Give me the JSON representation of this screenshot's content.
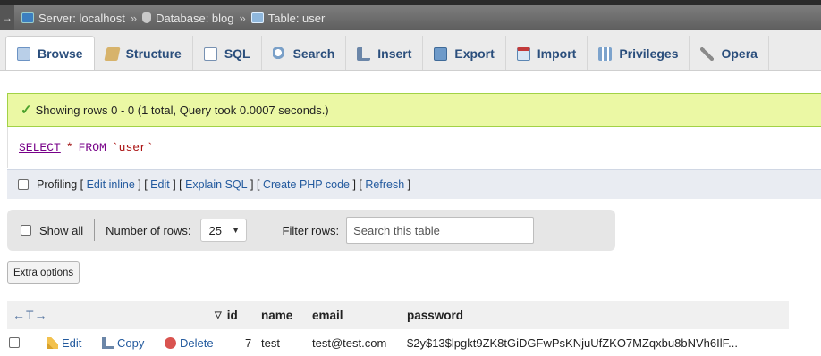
{
  "breadcrumb": {
    "server": "Server: localhost",
    "database": "Database: blog",
    "table": "Table: user",
    "separator": "»",
    "collapse": "→"
  },
  "tabs": [
    {
      "label": "Browse",
      "icon": "browse-icon",
      "active": true
    },
    {
      "label": "Structure",
      "icon": "structure-icon"
    },
    {
      "label": "SQL",
      "icon": "sql-icon"
    },
    {
      "label": "Search",
      "icon": "search-icon"
    },
    {
      "label": "Insert",
      "icon": "insert-icon"
    },
    {
      "label": "Export",
      "icon": "export-icon"
    },
    {
      "label": "Import",
      "icon": "import-icon"
    },
    {
      "label": "Privileges",
      "icon": "privileges-icon"
    },
    {
      "label": "Opera",
      "icon": "operations-icon"
    }
  ],
  "message": {
    "check": "✓",
    "text": "Showing rows 0 - 0 (1 total, Query took 0.0007 seconds.)"
  },
  "query": {
    "select": "SELECT",
    "star": "*",
    "from": "FROM",
    "table": "`user`"
  },
  "profiling": {
    "label": "Profiling",
    "links": [
      "Edit inline",
      "Edit",
      "Explain SQL",
      "Create PHP code",
      "Refresh"
    ]
  },
  "navigation": {
    "show_all": "Show all",
    "rows_label": "Number of rows:",
    "rows_value": "25",
    "filter_label": "Filter rows:",
    "filter_placeholder": "Search this table"
  },
  "extra_options": "Extra options",
  "table": {
    "arrows": "←T→",
    "sort_indicator": "▽",
    "columns": [
      "id",
      "name",
      "email",
      "password"
    ],
    "actions": {
      "edit": "Edit",
      "copy": "Copy",
      "delete": "Delete"
    },
    "rows": [
      {
        "id": "7",
        "name": "test",
        "email": "test@test.com",
        "password": "$2y$13$lpgkt9ZK8tGiDGFwPsKNjuUfZKO7MZqxbu8bNVh6IlF..."
      }
    ]
  },
  "colors": {
    "success_bg": "#ebf8a4",
    "link": "#235a9e",
    "tab_text": "#2a4e7c"
  }
}
